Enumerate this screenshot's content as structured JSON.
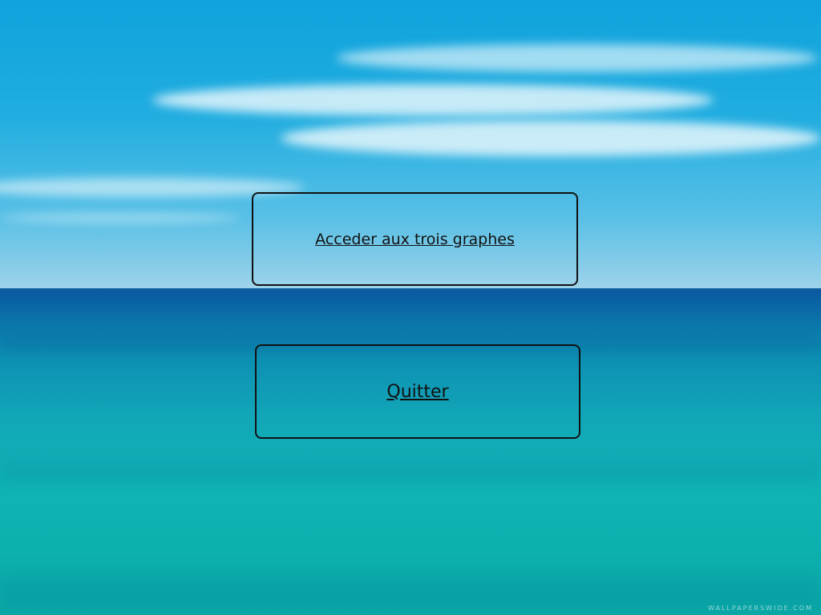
{
  "menu": {
    "graphs_button_label": "Acceder aux trois graphes",
    "quit_button_label": "Quitter"
  },
  "background": {
    "watermark_text": "WALLPAPERSWIDE.COM",
    "sky_color": "#21ade0",
    "sea_color": "#0fb4b4",
    "button_border_color": "#111111"
  }
}
